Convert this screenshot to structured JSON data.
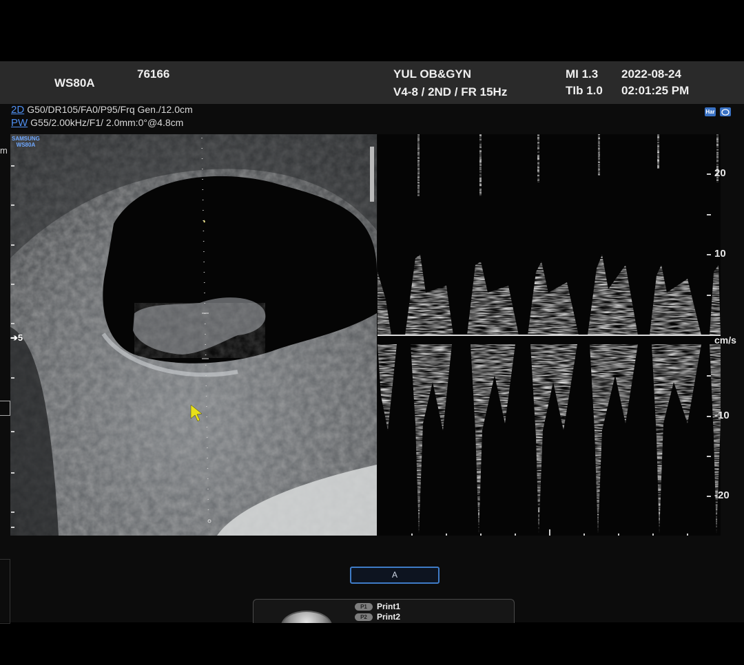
{
  "header": {
    "model": "WS80A",
    "id": "76166",
    "institution": "YUL OB&GYN",
    "probe_info": "V4-8 / 2ND / FR 15Hz",
    "mi": "MI  1.3",
    "tib": "TIb 1.0",
    "date": "2022-08-24",
    "time": "02:01:25 PM"
  },
  "params": {
    "mode_2d_key": "2D",
    "mode_2d_values": "G50/DR105/FA0/P95/Frq Gen./12.0cm",
    "mode_pw_key": "PW",
    "mode_pw_values": "G55/2.00kHz/F1/ 2.0mm:0°@4.8cm"
  },
  "logo": {
    "line1": "SAMSUNG",
    "line2": "WS80A"
  },
  "icons": {
    "harmonic": "Har",
    "probe": "probe-icon"
  },
  "bmode": {
    "left_edge_label": "m",
    "depth_marker": "5"
  },
  "doppler": {
    "unit": "cm/s",
    "scale_labels": [
      "20",
      "10",
      "-10",
      "-20"
    ]
  },
  "bottom": {
    "selector_label": "A",
    "print1_key": "P1",
    "print1_label": "Print1",
    "print2_key": "P2",
    "print2_label": "Print2"
  },
  "colors": {
    "accent_blue": "#3f7cc8",
    "cursor_yellow": "#e8e019",
    "header_bg": "#2a2a2a"
  }
}
